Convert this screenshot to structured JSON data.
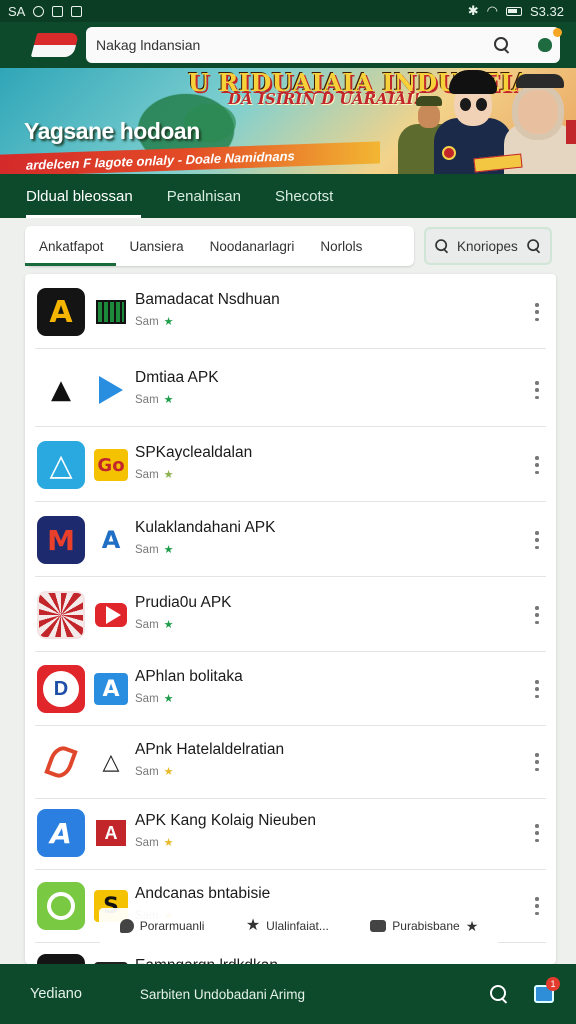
{
  "status_bar": {
    "left_text": "SA",
    "time": "S3.32"
  },
  "header": {
    "search_placeholder": "Nakag lndansian"
  },
  "banner": {
    "title": "U RIDUAIAIA INDUNEIA",
    "subtitle": "DA ISIRIN D UARAIAI!",
    "headline": "Yagsane hodoan",
    "strip_text": "ardelcen F Iagote onlaly - Doale Namidnans"
  },
  "tabs": [
    {
      "label": "Dldual bleossan"
    },
    {
      "label": "Penalnisan"
    },
    {
      "label": "Shecotst"
    }
  ],
  "filters": {
    "chips": [
      {
        "label": "Ankatfapot"
      },
      {
        "label": "Uansiera"
      },
      {
        "label": "Noodanarlagri"
      },
      {
        "label": "Norlols"
      }
    ],
    "search_label": "Knoriopes"
  },
  "apps": [
    {
      "title": "Bamadacat Nsdhuan",
      "meta": "Sam",
      "star_color": "#1e9e4a",
      "icon": "a-icon",
      "sub_icon": "grid-icon",
      "icon_bg": "#141414",
      "icon_fg": "#f4b400",
      "sub_bg": "#ffffff"
    },
    {
      "title": "Dmtiaa APK",
      "meta": "Sam",
      "star_color": "#1e9e4a",
      "icon": "ab-icon",
      "sub_icon": "play-triangle-icon",
      "icon_bg": "#ffffff",
      "icon_fg": "#111111",
      "sub_bg": "#ffffff"
    },
    {
      "title": "SPKayclealdalan",
      "meta": "Sam",
      "star_color": "#8ab24a",
      "icon": "triangle-a-icon",
      "sub_icon": "go-icon",
      "icon_bg": "#29a9e0",
      "icon_fg": "#ffffff",
      "sub_bg": "#f4c200"
    },
    {
      "title": "Kulaklandahani APK",
      "meta": "Sam",
      "star_color": "#1e9e4a",
      "icon": "m-icon",
      "sub_icon": "blue-a-icon",
      "icon_bg": "#1e2a6e",
      "icon_fg": "#e8402b",
      "sub_bg": "#ffffff"
    },
    {
      "title": "Prudia0u APK",
      "meta": "Sam",
      "star_color": "#1e9e4a",
      "icon": "pattern-icon",
      "sub_icon": "youtube-icon",
      "icon_bg": "#f3e3e3",
      "icon_fg": "#c2262b",
      "sub_bg": "#ffffff"
    },
    {
      "title": "APhlan bolitaka",
      "meta": "Sam",
      "star_color": "#1e9e4a",
      "icon": "d-circle-icon",
      "sub_icon": "a-square-icon",
      "icon_bg": "#e0262b",
      "icon_fg": "#1d4ea8",
      "sub_bg": "#2a8ee0"
    },
    {
      "title": "APnk Hatelaldelratian",
      "meta": "Sam",
      "star_color": "#e8b92a",
      "icon": "leaf-icon",
      "sub_icon": "outline-a-icon",
      "icon_bg": "#ffffff",
      "icon_fg": "#e0462b",
      "sub_bg": "#ffffff"
    },
    {
      "title": "APK Kang Kolaig Nieuben",
      "meta": "Sam",
      "star_color": "#e8b92a",
      "icon": "blue-swoosh-icon",
      "sub_icon": "red-a-icon",
      "icon_bg": "#2a7fe0",
      "icon_fg": "#ffffff",
      "sub_bg": "#ffffff"
    },
    {
      "title": "Andcanas bntabisie",
      "meta": "Sam",
      "star_color": "#e8b92a",
      "icon": "green-phone-icon",
      "sub_icon": "s-icon",
      "icon_bg": "#7ac943",
      "icon_fg": "#ffffff",
      "sub_bg": "#f4c200"
    },
    {
      "title": "Eamngarqn lrdkdkan",
      "meta": "",
      "star_color": "#1e9e4a",
      "icon": "dark-a-icon",
      "sub_icon": "dark-sq-icon",
      "icon_bg": "#141414",
      "icon_fg": "#d93a2b",
      "sub_bg": "#222222"
    }
  ],
  "float_bar": [
    {
      "label": "Porarmuanli",
      "icon": "pin-icon"
    },
    {
      "label": "Ulalinfaiat...",
      "icon": "star-icon"
    },
    {
      "label": "Purabisbane",
      "icon": "chat-icon"
    }
  ],
  "bottom_nav": {
    "brand": "Yediano",
    "text": "Sarbiten Undobadani Arimg",
    "notif_count": "1"
  },
  "colors": {
    "primary": "#0d4a2b",
    "accent": "#1e9e4a"
  }
}
